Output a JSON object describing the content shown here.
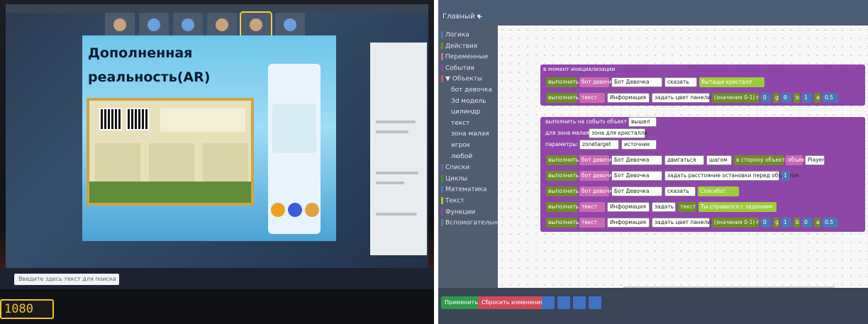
{
  "left_photo": {
    "slide_title": "Дополненная реальность(AR)",
    "taskbar_search": "Введите здесь текст для поиска",
    "monitor_sticker": "1080"
  },
  "right_photo": {
    "workspace_tab": "Главный ▾",
    "add_tab": "+",
    "categories": [
      {
        "label": "Логика",
        "color": "#4a79b6"
      },
      {
        "label": "Действия",
        "color": "#6f8b26"
      },
      {
        "label": "Переменные",
        "color": "#c96bb0"
      },
      {
        "label": "События",
        "color": "#8f46a9"
      },
      {
        "label": "▼ Объекты",
        "color": "#d05a5a"
      },
      {
        "label": "бот девочка",
        "color": ""
      },
      {
        "label": "3d модель",
        "color": ""
      },
      {
        "label": "цилиндр",
        "color": ""
      },
      {
        "label": "текст",
        "color": ""
      },
      {
        "label": "зона малая",
        "color": ""
      },
      {
        "label": "игрок",
        "color": ""
      },
      {
        "label": "любой",
        "color": ""
      },
      {
        "label": "Списки",
        "color": "#6d5bb0"
      },
      {
        "label": "Циклы",
        "color": "#4a8b3c"
      },
      {
        "label": "Математика",
        "color": "#4a79b6"
      },
      {
        "label": "Текст",
        "color": "#9ecb3b"
      },
      {
        "label": "Функции",
        "color": "#8f46a9"
      },
      {
        "label": "Вспомогательное",
        "color": "#607d8b"
      }
    ],
    "init_block": {
      "header": "в момент инициализации",
      "row1": {
        "do": "выполнить",
        "obj": "бот девочка",
        "target": "Бот Девочка",
        "action": "сказать",
        "text": "Вытащи кристалл"
      },
      "row2": {
        "do": "выполнить",
        "obj": "текст",
        "target": "Информация",
        "action": "задать цвет панели",
        "range": "(значения 0-1) r",
        "r": "0",
        "g_label": "g",
        "g": "0",
        "b_label": "b",
        "b": "1",
        "a_label": "a",
        "a": "0.5"
      }
    },
    "event_block": {
      "header": "выполнить на событие",
      "object_label": "объект",
      "event_name": "вышел",
      "for_label": "для",
      "zone_label": "зона малая",
      "zone_value": "зона для кристалла",
      "params_label": "параметры:",
      "param1": "zonetarget",
      "param2": "источник",
      "rows": [
        {
          "do": "выполнить",
          "obj": "бот девочка",
          "target": "Бот Девочка",
          "action": "двигаться",
          "mode": "шагом",
          "dir": "в сторону объекта",
          "dir_obj": "объект",
          "dir_target": "Player"
        },
        {
          "do": "выполнить",
          "obj": "бот девочка",
          "target": "Бот Девочка",
          "action": "задать расстояние остановки перед объектом",
          "value": "1"
        },
        {
          "do": "выполнить",
          "obj": "бот девочка",
          "target": "Бот Девочка",
          "action": "сказать",
          "text": "Спасибо!"
        },
        {
          "do": "выполнить",
          "obj": "текст",
          "target": "Информация",
          "action": "задать",
          "field": "текст",
          "text": "Ты справился с заданием"
        },
        {
          "do": "выполнить",
          "obj": "текст",
          "target": "Информация",
          "action": "задать цвет панели",
          "range": "(значения 0-1) r",
          "r": "0",
          "g_label": "g",
          "g": "1",
          "b_label": "b",
          "b": "0",
          "a_label": "a",
          "a": "0.5"
        }
      ]
    },
    "bottom_buttons": {
      "apply": "Применить",
      "reset": "Сбросить изменения"
    },
    "colors": {
      "event_purple": "#8f46a9",
      "action_green": "#6f8b26",
      "variable_pink": "#c96bb0",
      "apply_green": "#2f9a4a",
      "reset_red": "#d24a5a"
    }
  }
}
